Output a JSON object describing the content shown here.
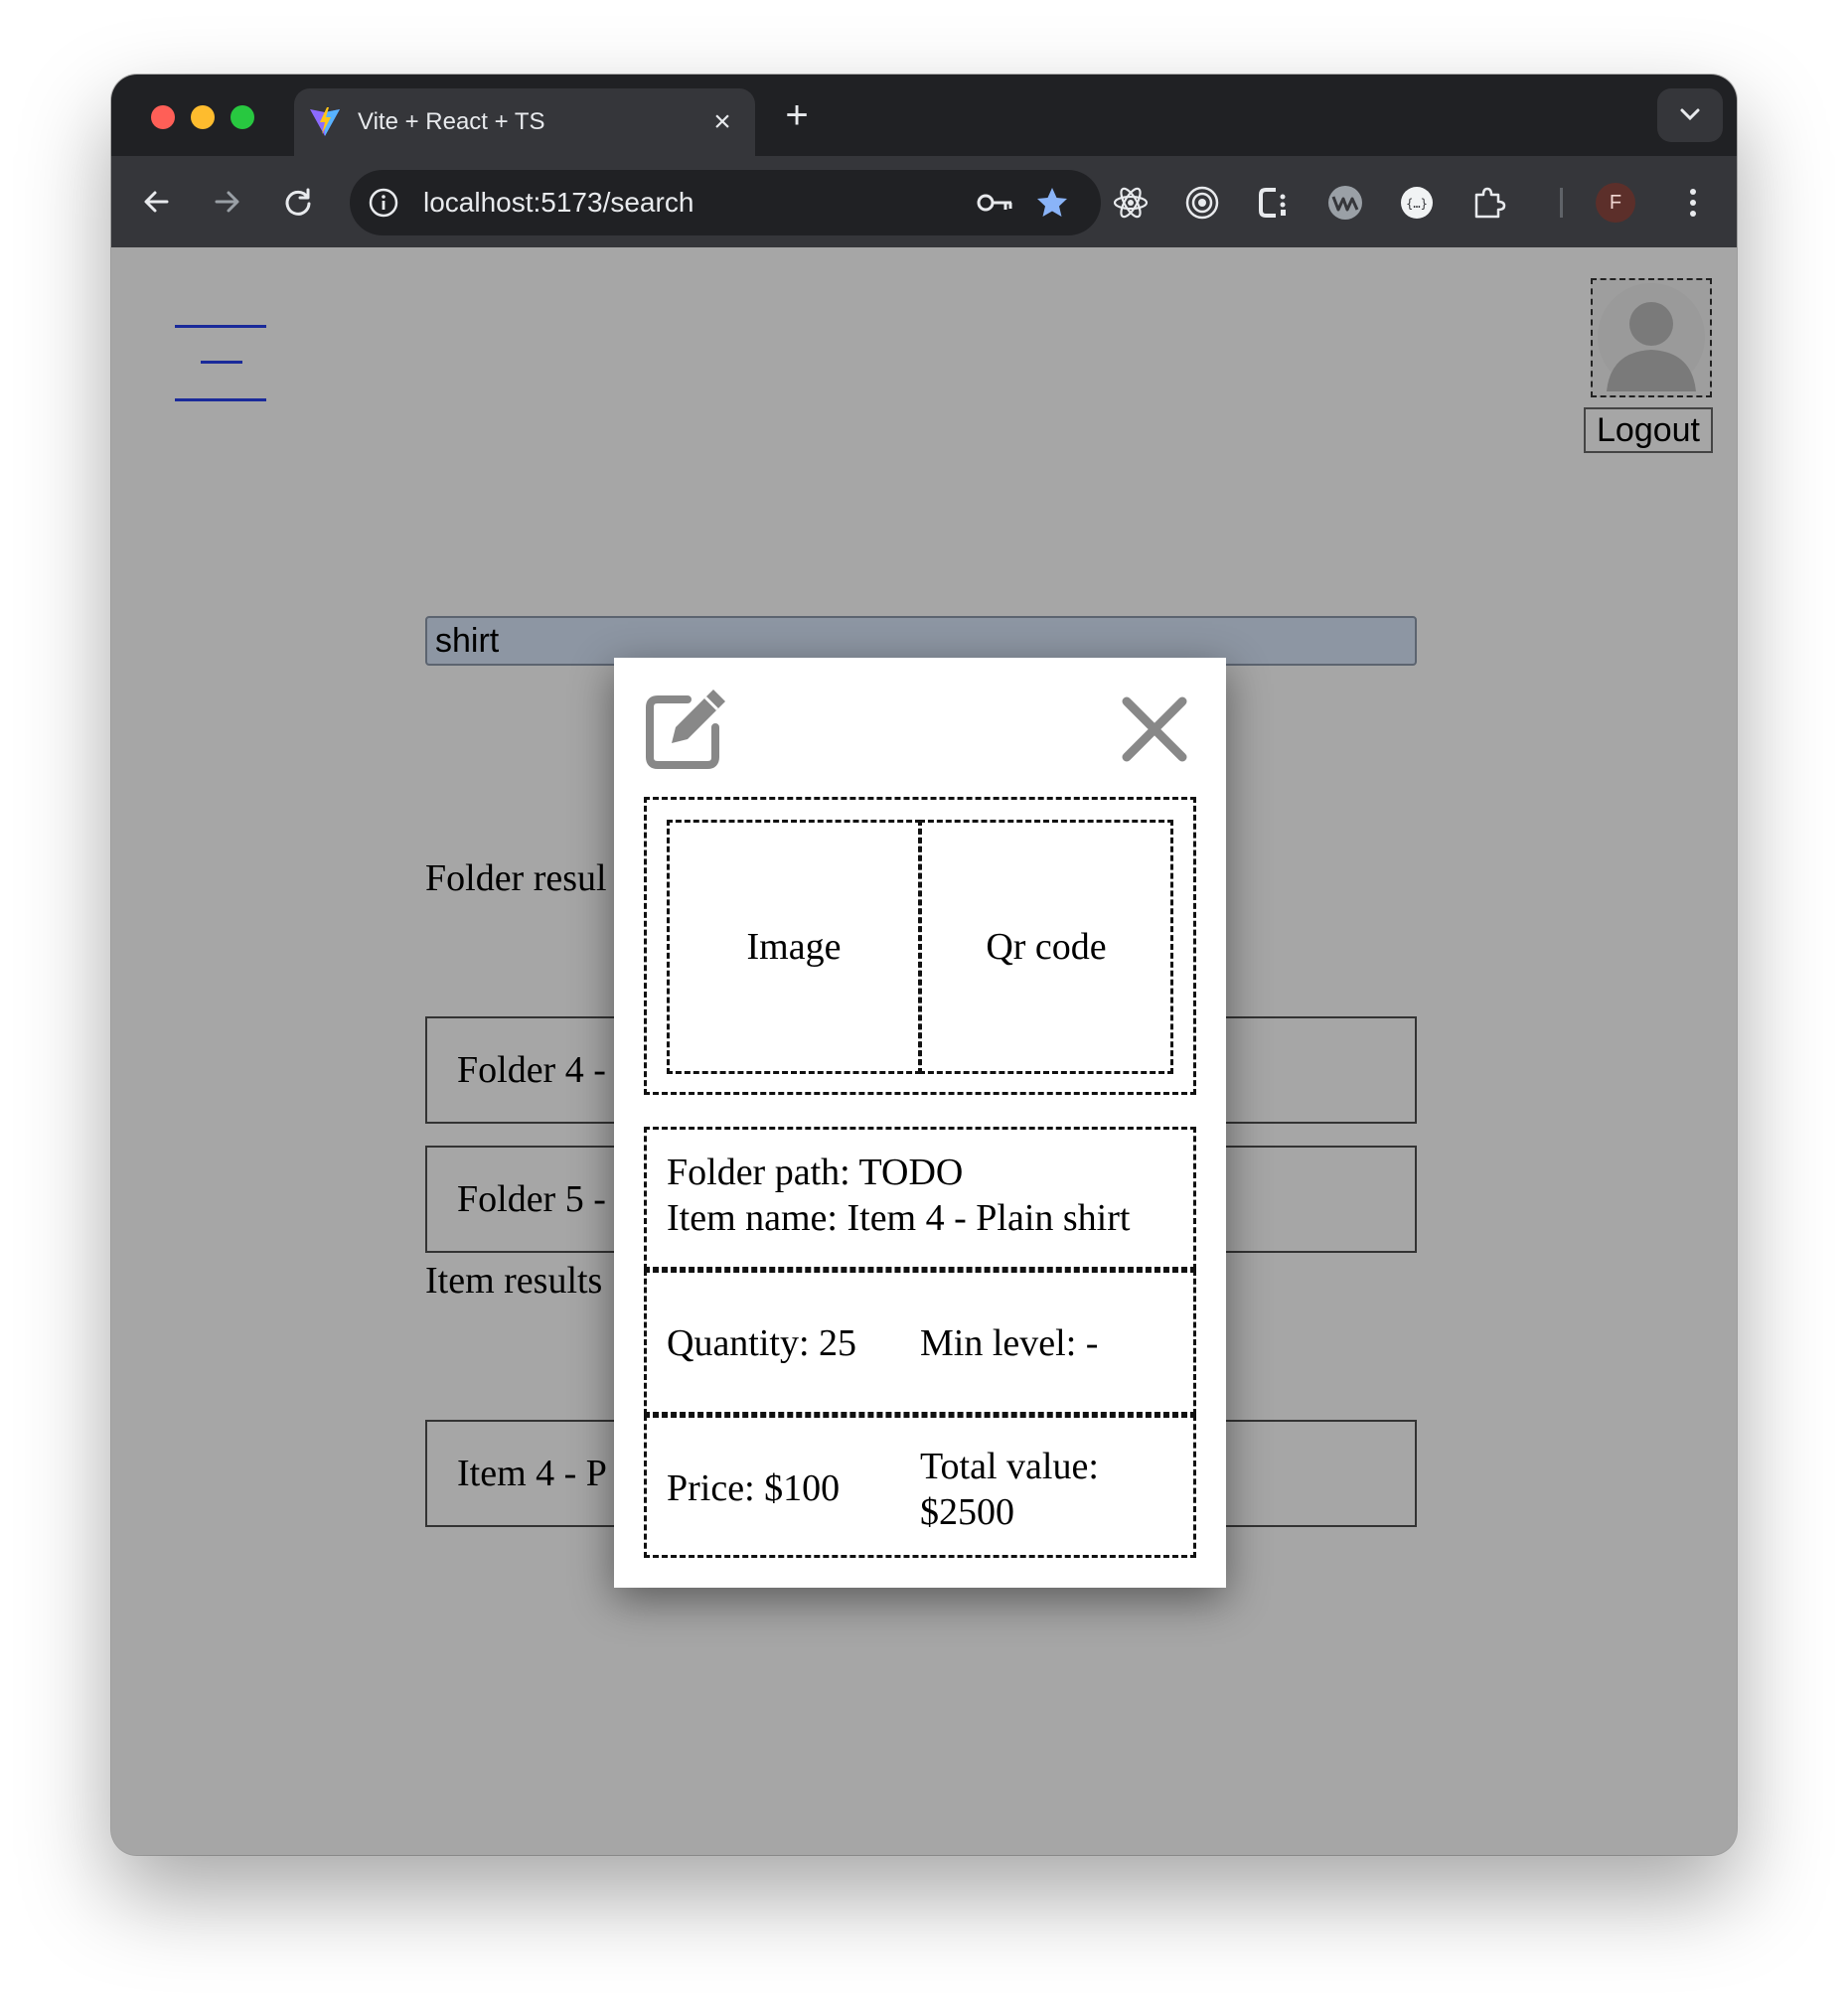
{
  "browser": {
    "tab_title": "Vite + React + TS",
    "tab_close": "×",
    "new_tab": "+",
    "url": "localhost:5173/search",
    "profile_initial": "F"
  },
  "header": {
    "logout_label": "Logout"
  },
  "search": {
    "value": "shirt"
  },
  "folder_results": {
    "heading": "Folder resul",
    "items": [
      "Folder 4 -",
      "Folder 5 -"
    ]
  },
  "item_results": {
    "heading": "Item results",
    "items": [
      "Item 4 - P"
    ]
  },
  "modal": {
    "image_label": "Image",
    "qr_label": "Qr code",
    "folder_path": "Folder path: TODO",
    "item_name": "Item name: Item 4 - Plain shirt",
    "quantity": "Quantity: 25",
    "min_level": "Min level: -",
    "price": "Price: $100",
    "total_value_label": "Total value:",
    "total_value_amount": "$2500"
  },
  "icons": {
    "favicon": "vite-logo-icon",
    "edit": "edit-icon",
    "close": "close-icon",
    "avatar": "avatar-placeholder-icon"
  },
  "colors": {
    "page_background": "#a6a6a6",
    "hamburger": "#1a2a9a",
    "search_background": "#8d96a3",
    "icon_gray": "#888888"
  }
}
